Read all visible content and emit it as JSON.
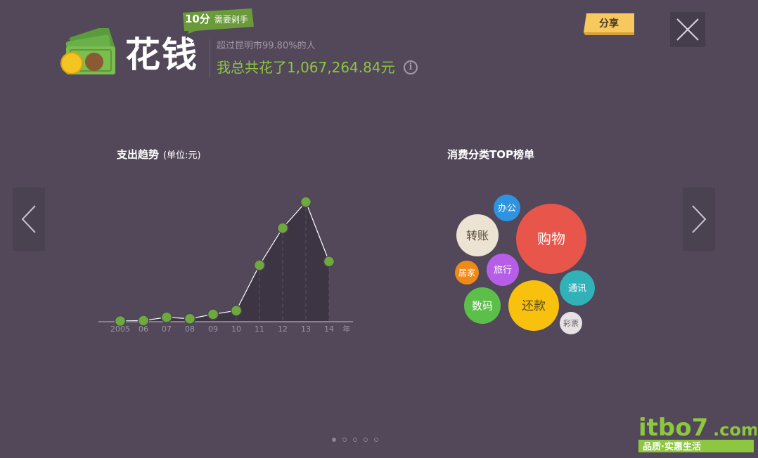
{
  "header": {
    "title": "花钱",
    "score": "10分",
    "score_level": "需要剁手",
    "rank_text": "超过昆明市99.80%的人",
    "total_text": "我总共花了1,067,264.84元",
    "info_icon": "info-icon",
    "share_label": "分享"
  },
  "colors": {
    "background": "#524859",
    "accent_green": "#8dc63f",
    "share_yellow": "#f6c85e"
  },
  "trend": {
    "title": "支出趋势",
    "unit": "(单位:元)"
  },
  "top": {
    "title": "消费分类TOP榜单",
    "bubbles": [
      {
        "label": "购物",
        "color": "#e8554a"
      },
      {
        "label": "办公",
        "color": "#2e93e0"
      },
      {
        "label": "转账",
        "color": "#ece3d2"
      },
      {
        "label": "旅行",
        "color": "#b65ee8"
      },
      {
        "label": "居家",
        "color": "#f08a17"
      },
      {
        "label": "数码",
        "color": "#5cbf49"
      },
      {
        "label": "还款",
        "color": "#f8c10e"
      },
      {
        "label": "通讯",
        "color": "#31b1b8"
      },
      {
        "label": "彩票",
        "color": "#e6e2e4"
      }
    ]
  },
  "chart_data": {
    "type": "area",
    "title": "支出趋势",
    "unit": "(单位:元)",
    "categories": [
      "2005",
      "06",
      "07",
      "08",
      "09",
      "10",
      "11",
      "12",
      "13",
      "14"
    ],
    "x_unit_label": "年",
    "values": [
      2,
      3,
      12,
      8,
      20,
      30,
      152,
      252,
      322,
      162
    ],
    "ylim": [
      0,
      340
    ],
    "grid": false,
    "legend": "none"
  },
  "pagination": {
    "pages": 5,
    "active": 0
  },
  "watermark": {
    "brand": "itbo7",
    "domain": ".com",
    "slogan": "品质·实惠生活"
  }
}
